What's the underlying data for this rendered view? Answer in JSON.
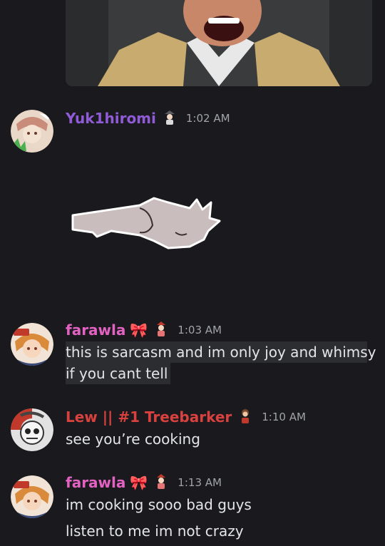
{
  "colors": {
    "background": "#1a1a1e",
    "yuki_name": "#8f5bd6",
    "farawla_name": "#e262c2",
    "lew_name": "#d8413d",
    "timestamp": "#a0a3aa",
    "message_text": "#e3e5e8",
    "highlight": "#2c2d31"
  },
  "video_attachment": {
    "icon": "video-thumbnail-laughing-man"
  },
  "messages": [
    {
      "user": "Yuk1hiromi",
      "timestamp": "1:02 AM",
      "badge_icon": "role-badge-icon",
      "attachment_icon": "sticker-lying-cat"
    },
    {
      "user": "farawla",
      "name_emoji": "🎀",
      "timestamp": "1:03 AM",
      "badge_icon": "role-badge-icon",
      "lines": [
        "this is sarcasm and im only joy and whimsy",
        "if you cant tell"
      ]
    },
    {
      "user": "Lew || #1 Treebarker",
      "timestamp": "1:10 AM",
      "badge_icon": "role-badge-icon",
      "lines": [
        "see you’re cooking"
      ]
    },
    {
      "user": "farawla",
      "name_emoji": "🎀",
      "timestamp": "1:13 AM",
      "badge_icon": "role-badge-icon",
      "lines": [
        "im cooking sooo bad guys",
        "listen to me im not crazy"
      ]
    }
  ]
}
